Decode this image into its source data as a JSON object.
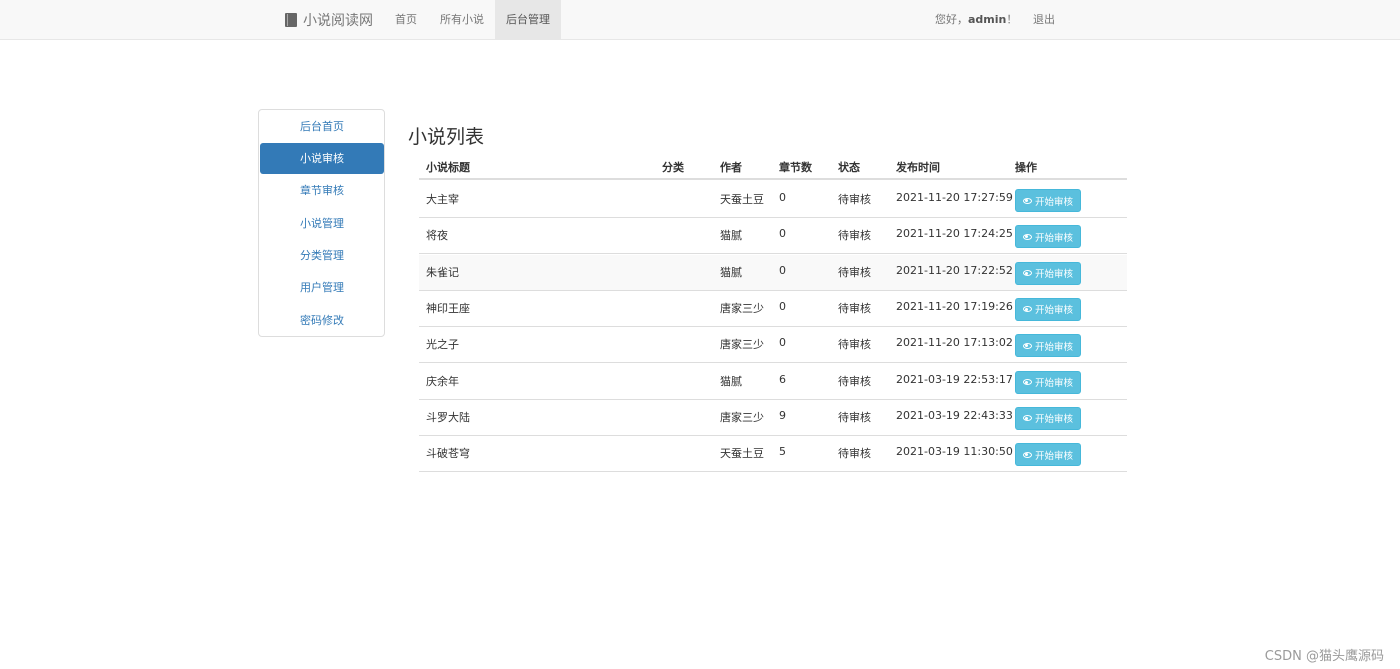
{
  "navbar": {
    "brand": "小说阅读网",
    "links": [
      {
        "label": "首页"
      },
      {
        "label": "所有小说"
      },
      {
        "label": "后台管理"
      }
    ],
    "greeting_prefix": "您好，",
    "username": "admin",
    "greeting_suffix": "！",
    "logout": "退出"
  },
  "sidebar": {
    "items": [
      {
        "label": "后台首页"
      },
      {
        "label": "小说审核"
      },
      {
        "label": "章节审核"
      },
      {
        "label": "小说管理"
      },
      {
        "label": "分类管理"
      },
      {
        "label": "用户管理"
      },
      {
        "label": "密码修改"
      }
    ],
    "active_index": 1
  },
  "main": {
    "title": "小说列表",
    "columns": [
      "小说标题",
      "分类",
      "作者",
      "章节数",
      "状态",
      "发布时间",
      "操作"
    ],
    "rows": [
      {
        "title": "大主宰",
        "category": "",
        "author": "天蚕土豆",
        "chapters": "0",
        "status": "待审核",
        "published": "2021-11-20 17:27:59",
        "action": "开始审核"
      },
      {
        "title": "将夜",
        "category": "",
        "author": "猫腻",
        "chapters": "0",
        "status": "待审核",
        "published": "2021-11-20 17:24:25",
        "action": "开始审核"
      },
      {
        "title": "朱雀记",
        "category": "",
        "author": "猫腻",
        "chapters": "0",
        "status": "待审核",
        "published": "2021-11-20 17:22:52",
        "action": "开始审核"
      },
      {
        "title": "神印王座",
        "category": "",
        "author": "唐家三少",
        "chapters": "0",
        "status": "待审核",
        "published": "2021-11-20 17:19:26",
        "action": "开始审核"
      },
      {
        "title": "光之子",
        "category": "",
        "author": "唐家三少",
        "chapters": "0",
        "status": "待审核",
        "published": "2021-11-20 17:13:02",
        "action": "开始审核"
      },
      {
        "title": "庆余年",
        "category": "",
        "author": "猫腻",
        "chapters": "6",
        "status": "待审核",
        "published": "2021-03-19 22:53:17",
        "action": "开始审核"
      },
      {
        "title": "斗罗大陆",
        "category": "",
        "author": "唐家三少",
        "chapters": "9",
        "status": "待审核",
        "published": "2021-03-19 22:43:33",
        "action": "开始审核"
      },
      {
        "title": "斗破苍穹",
        "category": "",
        "author": "天蚕土豆",
        "chapters": "5",
        "status": "待审核",
        "published": "2021-03-19 11:30:50",
        "action": "开始审核"
      }
    ]
  },
  "watermark": "CSDN @猫头鹰源码",
  "colors": {
    "primary": "#337ab7",
    "info_button": "#5bc0de"
  },
  "icons": {
    "brand": "book-icon",
    "review_button": "eye-icon"
  }
}
